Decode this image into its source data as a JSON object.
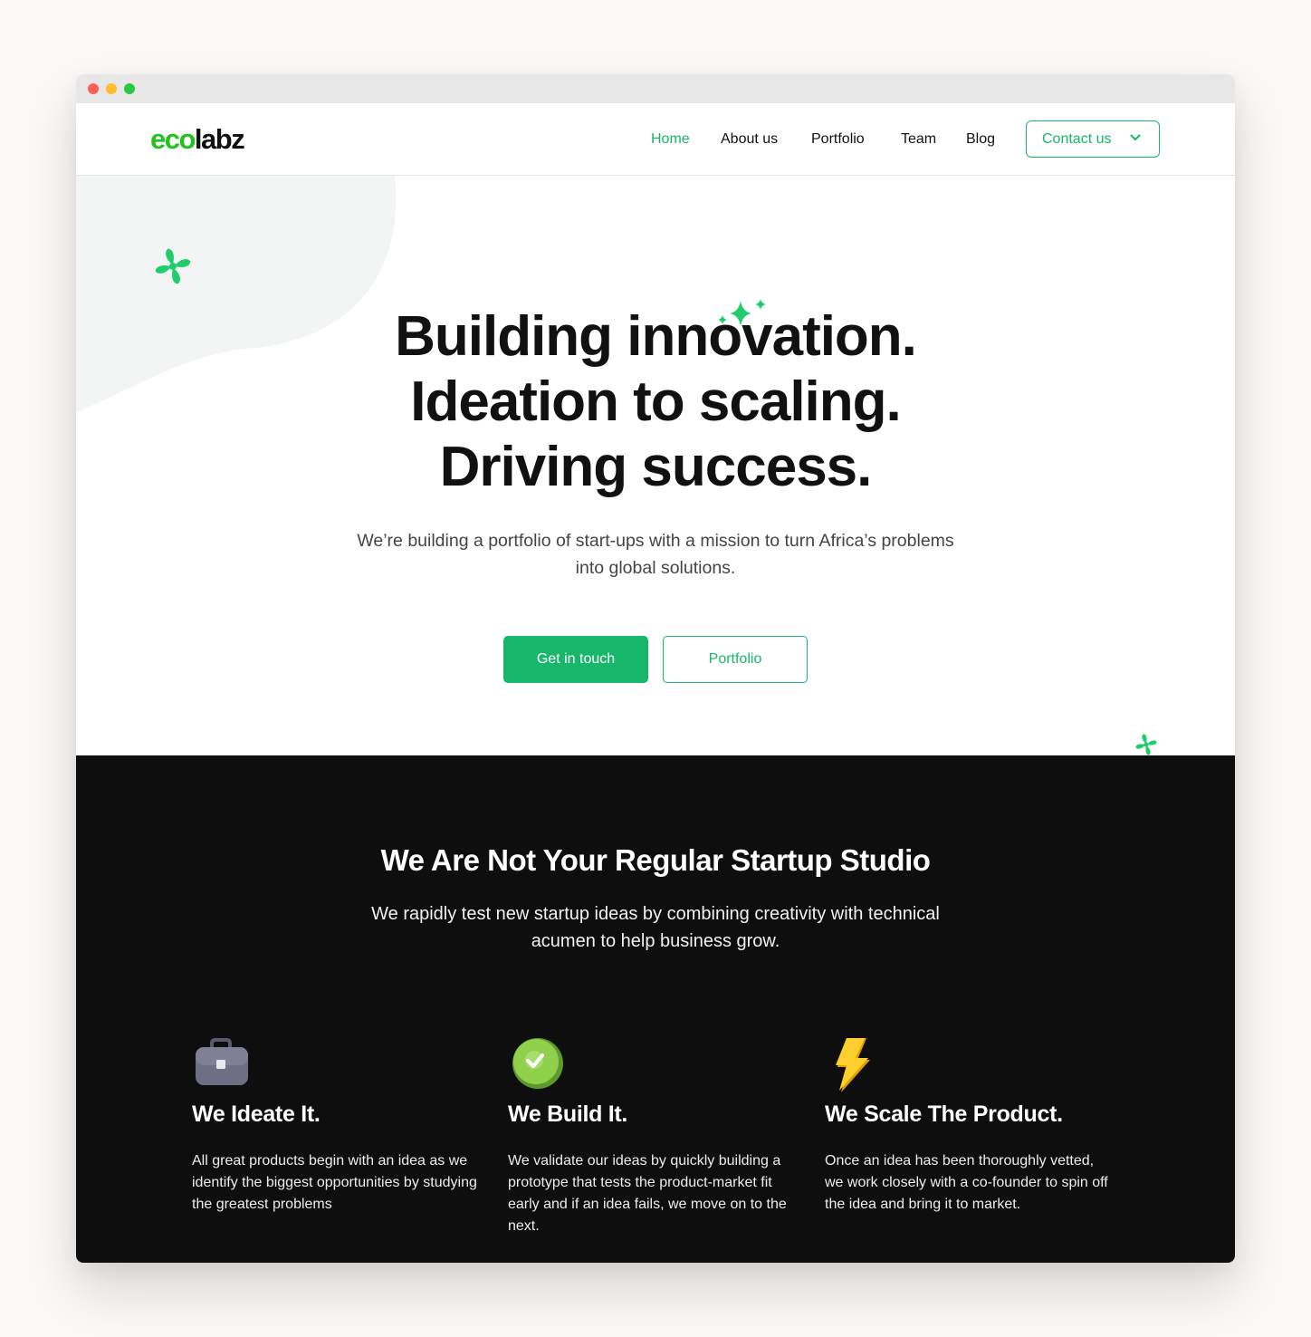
{
  "window": {
    "controls": [
      "close",
      "minimize",
      "zoom"
    ]
  },
  "brand": {
    "logo_part1": "eco",
    "logo_part2": "labz",
    "primary_color": "#17b66a",
    "logo_green": "#1fc51c"
  },
  "nav": {
    "items": [
      {
        "label": "Home",
        "active": true
      },
      {
        "label": "About us",
        "active": false
      },
      {
        "label": "Portfolio",
        "active": false
      },
      {
        "label": "Team",
        "active": false
      },
      {
        "label": "Blog",
        "active": false
      }
    ],
    "contact_label": "Contact us",
    "contact_icon": "chevron-down-icon"
  },
  "hero": {
    "title_lines": [
      "Building innovation.",
      "Ideation to scaling.",
      "Driving success."
    ],
    "subtitle": "We’re building a portfolio of start-ups with a mission to turn Africa’s problems into global solutions.",
    "primary_cta": "Get in touch",
    "secondary_cta": "Portfolio",
    "decor_icons": [
      "leaf-star-icon",
      "sparkle-icon",
      "small-leaf-star-icon"
    ]
  },
  "about": {
    "title": "We Are Not Your Regular Startup Studio",
    "subtitle": "We rapidly test new startup ideas by combining creativity with technical acumen to help business grow.",
    "background": "#0e0e0e",
    "features": [
      {
        "icon": "briefcase-icon",
        "title": "We Ideate It.",
        "text": "All great products begin with an idea as we identify the biggest opportunities by studying the greatest problems"
      },
      {
        "icon": "check-badge-icon",
        "title": "We Build It.",
        "text": "We validate our ideas by quickly building a prototype that tests the product-market fit early and if an idea fails, we move on to the next."
      },
      {
        "icon": "lightning-icon",
        "title": "We Scale The Product.",
        "text": "Once an idea has been thoroughly vetted, we work closely with a co-founder to spin off the idea and bring it to market."
      }
    ]
  }
}
